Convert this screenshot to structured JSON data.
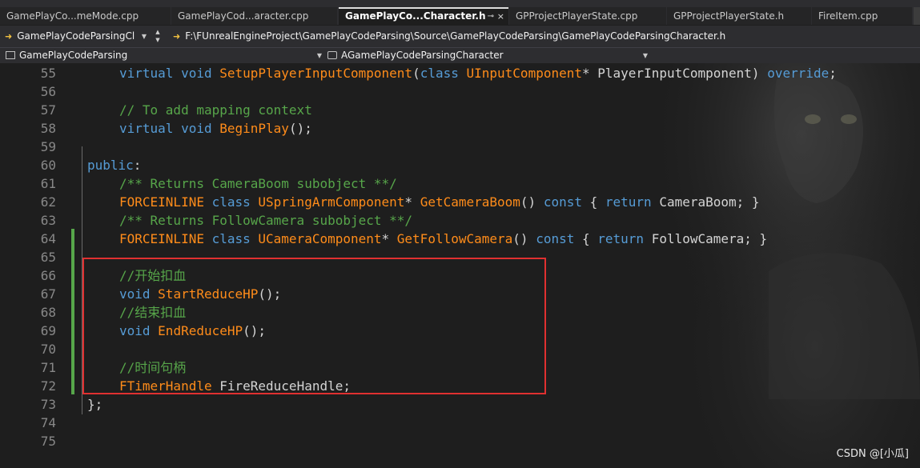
{
  "tabs": [
    {
      "label": "GamePlayCo...meMode.cpp",
      "active": false
    },
    {
      "label": "GamePlayCod...aracter.cpp",
      "active": false
    },
    {
      "label": "GamePlayCo...Character.h",
      "active": true,
      "pin": "⊸",
      "close": "×"
    },
    {
      "label": "GPProjectPlayerState.cpp",
      "active": false
    },
    {
      "label": "GPProjectPlayerState.h",
      "active": false
    },
    {
      "label": "FireItem.cpp",
      "active": false
    }
  ],
  "nav": {
    "project": "GamePlayCodeParsingCl",
    "path": "F:\\FUnrealEngineProject\\GamePlayCodeParsing\\Source\\GamePlayCodeParsing\\GamePlayCodeParsingCharacter.h"
  },
  "scope": {
    "project": "GamePlayCodeParsing",
    "class": "AGamePlayCodeParsingCharacter"
  },
  "editor": {
    "lines": [
      {
        "n": "55",
        "tokens": [
          [
            "kw",
            "virtual "
          ],
          [
            "kw",
            "void "
          ],
          [
            "fn",
            "SetupPlayerInputComponent"
          ],
          [
            "pl",
            "("
          ],
          [
            "kw",
            "class "
          ],
          [
            "ty",
            "UInputComponent"
          ],
          [
            "pl",
            "* "
          ],
          [
            "va",
            "PlayerInputComponent"
          ],
          [
            "pl",
            ") "
          ],
          [
            "kw",
            "override"
          ],
          [
            "pl",
            ";"
          ]
        ],
        "indent": 1
      },
      {
        "n": "56",
        "tokens": [],
        "indent": 1
      },
      {
        "n": "57",
        "tokens": [
          [
            "cm",
            "// To add mapping context"
          ]
        ],
        "indent": 1
      },
      {
        "n": "58",
        "tokens": [
          [
            "kw",
            "virtual "
          ],
          [
            "kw",
            "void "
          ],
          [
            "fn",
            "BeginPlay"
          ],
          [
            "pl",
            "();"
          ]
        ],
        "indent": 1
      },
      {
        "n": "59",
        "tokens": [],
        "indent": 1
      },
      {
        "n": "60",
        "tokens": [
          [
            "kw",
            "public"
          ],
          [
            "pl",
            ":"
          ]
        ],
        "indent": 0
      },
      {
        "n": "61",
        "tokens": [
          [
            "cm",
            "/** Returns CameraBoom subobject **/"
          ]
        ],
        "indent": 1
      },
      {
        "n": "62",
        "tokens": [
          [
            "mac",
            "FORCEINLINE "
          ],
          [
            "kw",
            "class "
          ],
          [
            "ty",
            "USpringArmComponent"
          ],
          [
            "pl",
            "* "
          ],
          [
            "fn",
            "GetCameraBoom"
          ],
          [
            "pl",
            "() "
          ],
          [
            "kw",
            "const "
          ],
          [
            "pl",
            "{ "
          ],
          [
            "kw",
            "return "
          ],
          [
            "va",
            "CameraBoom"
          ],
          [
            "pl",
            "; }"
          ]
        ],
        "indent": 1
      },
      {
        "n": "63",
        "tokens": [
          [
            "cm",
            "/** Returns FollowCamera subobject **/"
          ]
        ],
        "indent": 1
      },
      {
        "n": "64",
        "tokens": [
          [
            "mac",
            "FORCEINLINE "
          ],
          [
            "kw",
            "class "
          ],
          [
            "ty",
            "UCameraComponent"
          ],
          [
            "pl",
            "* "
          ],
          [
            "fn",
            "GetFollowCamera"
          ],
          [
            "pl",
            "() "
          ],
          [
            "kw",
            "const "
          ],
          [
            "pl",
            "{ "
          ],
          [
            "kw",
            "return "
          ],
          [
            "va",
            "FollowCamera"
          ],
          [
            "pl",
            "; }"
          ]
        ],
        "indent": 1
      },
      {
        "n": "65",
        "tokens": [],
        "indent": 1
      },
      {
        "n": "66",
        "tokens": [
          [
            "cm",
            "//开始扣血"
          ]
        ],
        "indent": 1
      },
      {
        "n": "67",
        "tokens": [
          [
            "kw",
            "void "
          ],
          [
            "fn",
            "StartReduceHP"
          ],
          [
            "pl",
            "();"
          ]
        ],
        "indent": 1
      },
      {
        "n": "68",
        "tokens": [
          [
            "cm",
            "//结束扣血"
          ]
        ],
        "indent": 1
      },
      {
        "n": "69",
        "tokens": [
          [
            "kw",
            "void "
          ],
          [
            "fn",
            "EndReduceHP"
          ],
          [
            "pl",
            "();"
          ]
        ],
        "indent": 1
      },
      {
        "n": "70",
        "tokens": [],
        "indent": 1
      },
      {
        "n": "71",
        "tokens": [
          [
            "cm",
            "//时间句柄"
          ]
        ],
        "indent": 1
      },
      {
        "n": "72",
        "tokens": [
          [
            "ty",
            "FTimerHandle "
          ],
          [
            "va",
            "FireReduceHandle"
          ],
          [
            "pl",
            ";"
          ]
        ],
        "indent": 1
      },
      {
        "n": "73",
        "tokens": [
          [
            "pl",
            "};"
          ]
        ],
        "indent": 0
      },
      {
        "n": "74",
        "tokens": [],
        "indent": 0
      },
      {
        "n": "75",
        "tokens": [],
        "indent": 0
      }
    ]
  },
  "watermark": "CSDN @[小瓜]",
  "colors": {
    "keyword": "#569cd6",
    "function": "#ff8c1a",
    "comment": "#57a64a",
    "highlight_box": "#e03030",
    "change_bar": "#57a64a"
  }
}
